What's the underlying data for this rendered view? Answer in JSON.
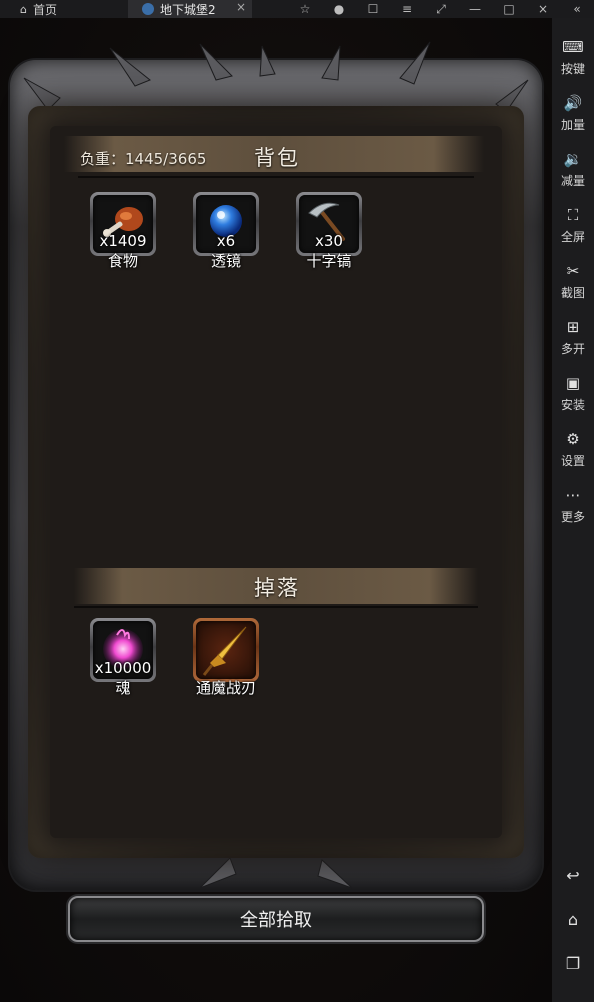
{
  "topbar": {
    "home_label": "首页",
    "game_tab_label": "地下城堡2",
    "close_symbol": "×",
    "window_icons": [
      "☆",
      "●",
      "☐",
      "≡",
      "⤢",
      "—",
      "□",
      "×",
      "«"
    ]
  },
  "sidebar": {
    "items": [
      {
        "label": "按键",
        "icon": "⌨"
      },
      {
        "label": "加量",
        "icon": "🔊"
      },
      {
        "label": "减量",
        "icon": "🔉"
      },
      {
        "label": "全屏",
        "icon": "⛶"
      },
      {
        "label": "截图",
        "icon": "✂"
      },
      {
        "label": "多开",
        "icon": "⊞"
      },
      {
        "label": "安装",
        "icon": "▣"
      },
      {
        "label": "设置",
        "icon": "⚙"
      },
      {
        "label": "更多",
        "icon": "⋯"
      }
    ],
    "bottom_icons": [
      "↩",
      "⌂",
      "❐"
    ]
  },
  "backpack": {
    "title": "背包",
    "weight": "负重：1445/3665",
    "items": [
      {
        "name": "食物",
        "count": "x1409",
        "icon": "food-drumstick-icon"
      },
      {
        "name": "透镜",
        "count": "x6",
        "icon": "lens-orb-icon"
      },
      {
        "name": "十字镐",
        "count": "x30",
        "icon": "pickaxe-icon"
      }
    ]
  },
  "drops": {
    "title": "掉落",
    "items": [
      {
        "name": "魂",
        "count": "x10000",
        "icon": "soul-orb-icon"
      },
      {
        "name": "通魔战刃",
        "count": "",
        "icon": "golden-blade-icon"
      }
    ]
  },
  "pickup_all_label": "全部拾取",
  "colors": {
    "panel": "#1f1b18",
    "header_band": "#5e4f3d",
    "frame_metal": "#4d4d52",
    "sidebar_bg": "#1c1c1e"
  }
}
